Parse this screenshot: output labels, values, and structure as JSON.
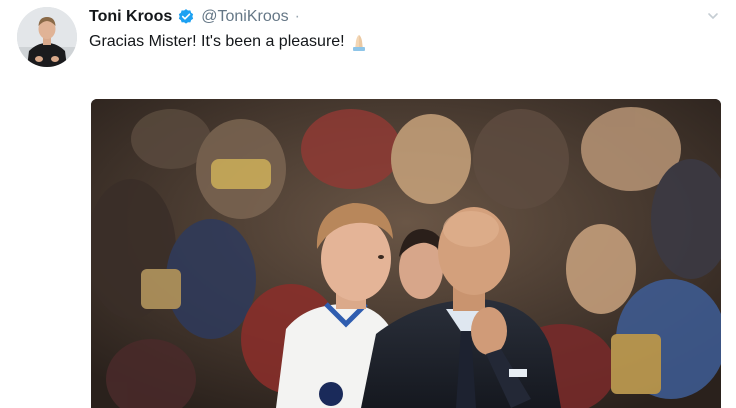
{
  "tweet": {
    "display_name": "Toni Kroos",
    "handle": "@ToniKroos",
    "separator": "·",
    "text": "Gracias Mister! It's been a pleasure!"
  },
  "icons": {
    "verified": "verified-badge-icon",
    "emoji": "folded-hands-emoji",
    "menu": "chevron-down-icon"
  },
  "colors": {
    "name": "#14171a",
    "handle": "#657786",
    "verified": "#1da1f2"
  }
}
